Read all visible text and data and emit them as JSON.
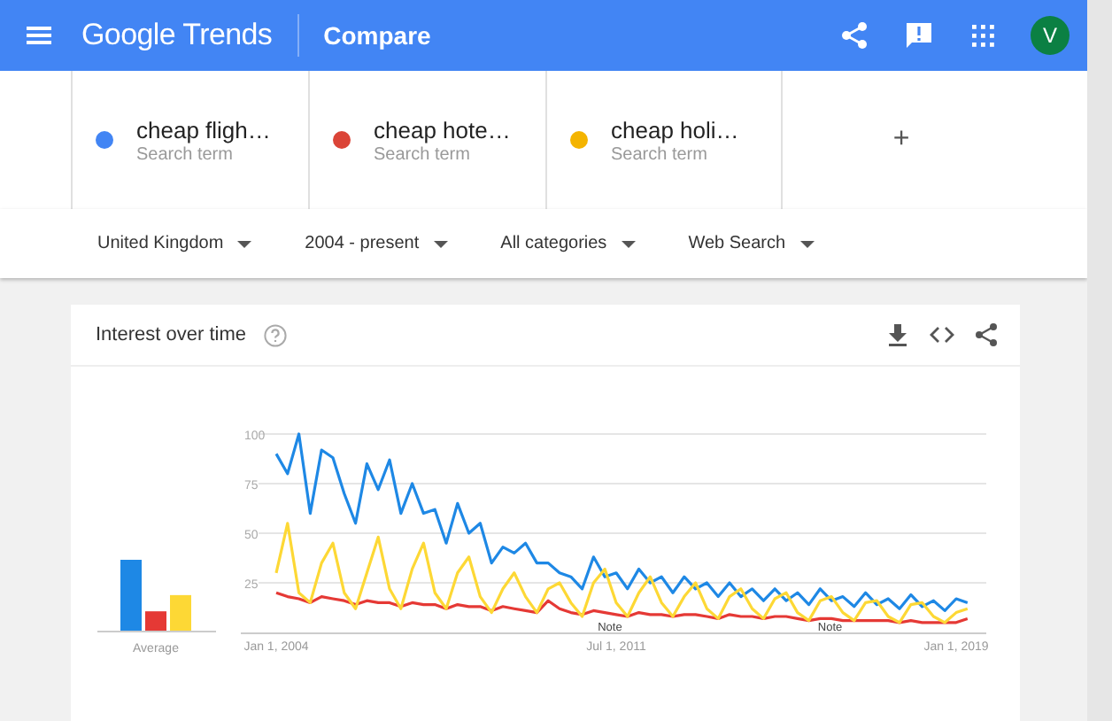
{
  "header": {
    "logo": "Google Trends",
    "title": "Compare",
    "avatar": "V"
  },
  "terms": [
    {
      "label": "cheap fligh…",
      "sublabel": "Search term",
      "color": "#4285f4"
    },
    {
      "label": "cheap hote…",
      "sublabel": "Search term",
      "color": "#db4437"
    },
    {
      "label": "cheap holi…",
      "sublabel": "Search term",
      "color": "#f4b400"
    }
  ],
  "add_term": "+",
  "filters": [
    "United Kingdom",
    "2004 - present",
    "All categories",
    "Web Search"
  ],
  "card": {
    "title": "Interest over time",
    "average_label": "Average",
    "chart_data": {
      "type": "line",
      "grid": true,
      "ylim": [
        0,
        100
      ],
      "categories": [
        "Jan 1, 2004",
        null,
        null,
        null,
        null,
        null,
        null,
        null,
        null,
        null,
        null,
        null,
        null,
        null,
        null,
        null,
        null,
        null,
        null,
        null,
        null,
        null,
        null,
        null,
        null,
        null,
        null,
        null,
        null,
        null,
        "Jul 1, 2011",
        null,
        null,
        null,
        null,
        null,
        null,
        null,
        null,
        null,
        null,
        null,
        null,
        null,
        null,
        null,
        null,
        null,
        null,
        null,
        null,
        null,
        null,
        null,
        null,
        null,
        null,
        null,
        null,
        null,
        "Jan 1, 2019",
        null
      ],
      "yticks": [
        25,
        50,
        75,
        100
      ],
      "series": [
        {
          "color": "#1e88e5",
          "values": [
            90,
            80,
            100,
            60,
            92,
            88,
            70,
            55,
            85,
            72,
            87,
            60,
            75,
            60,
            62,
            45,
            65,
            50,
            55,
            35,
            43,
            40,
            45,
            35,
            35,
            30,
            28,
            22,
            38,
            28,
            30,
            22,
            32,
            25,
            28,
            20,
            28,
            22,
            25,
            18,
            25,
            18,
            22,
            16,
            22,
            16,
            20,
            14,
            22,
            16,
            18,
            13,
            20,
            14,
            17,
            12,
            19,
            13,
            16,
            11,
            17,
            15
          ]
        },
        {
          "color": "#e53935",
          "values": [
            20,
            18,
            17,
            15,
            18,
            17,
            16,
            14,
            16,
            15,
            15,
            13,
            15,
            14,
            14,
            12,
            14,
            13,
            13,
            11,
            13,
            12,
            11,
            10,
            16,
            12,
            10,
            9,
            11,
            10,
            9,
            8,
            10,
            9,
            9,
            8,
            9,
            9,
            8,
            7,
            9,
            8,
            8,
            7,
            8,
            8,
            7,
            6,
            7,
            7,
            6,
            6,
            6,
            6,
            6,
            5,
            6,
            5,
            5,
            5,
            5,
            7
          ]
        },
        {
          "color": "#fdd835",
          "values": [
            30,
            55,
            20,
            15,
            35,
            45,
            20,
            12,
            30,
            48,
            22,
            12,
            32,
            45,
            20,
            12,
            30,
            38,
            18,
            10,
            22,
            30,
            18,
            10,
            22,
            25,
            15,
            8,
            25,
            32,
            15,
            8,
            20,
            28,
            15,
            8,
            18,
            25,
            12,
            7,
            18,
            22,
            12,
            7,
            17,
            20,
            10,
            6,
            16,
            18,
            10,
            6,
            15,
            16,
            8,
            5,
            14,
            15,
            8,
            5,
            10,
            12
          ]
        }
      ],
      "annotations": [
        "Note",
        "Note"
      ]
    }
  }
}
